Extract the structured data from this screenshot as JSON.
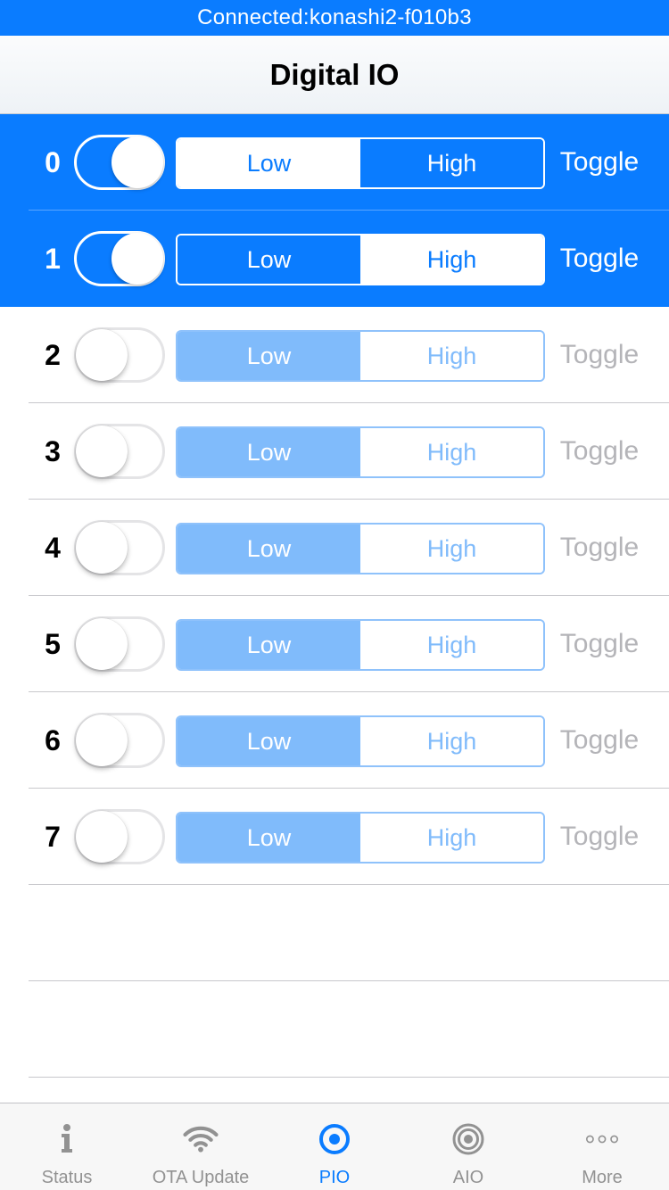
{
  "status_bar": {
    "text": "Connected:konashi2-f010b3"
  },
  "nav": {
    "title": "Digital IO"
  },
  "pins": [
    {
      "number": "0",
      "enabled": true,
      "value": "High",
      "low_label": "Low",
      "high_label": "High",
      "toggle_label": "Toggle"
    },
    {
      "number": "1",
      "enabled": true,
      "value": "Low",
      "low_label": "Low",
      "high_label": "High",
      "toggle_label": "Toggle"
    },
    {
      "number": "2",
      "enabled": false,
      "value": "Low",
      "low_label": "Low",
      "high_label": "High",
      "toggle_label": "Toggle"
    },
    {
      "number": "3",
      "enabled": false,
      "value": "Low",
      "low_label": "Low",
      "high_label": "High",
      "toggle_label": "Toggle"
    },
    {
      "number": "4",
      "enabled": false,
      "value": "Low",
      "low_label": "Low",
      "high_label": "High",
      "toggle_label": "Toggle"
    },
    {
      "number": "5",
      "enabled": false,
      "value": "Low",
      "low_label": "Low",
      "high_label": "High",
      "toggle_label": "Toggle"
    },
    {
      "number": "6",
      "enabled": false,
      "value": "Low",
      "low_label": "Low",
      "high_label": "High",
      "toggle_label": "Toggle"
    },
    {
      "number": "7",
      "enabled": false,
      "value": "Low",
      "low_label": "Low",
      "high_label": "High",
      "toggle_label": "Toggle"
    }
  ],
  "tabs": [
    {
      "label": "Status",
      "icon": "info-icon"
    },
    {
      "label": "OTA Update",
      "icon": "wifi-icon"
    },
    {
      "label": "PIO",
      "icon": "pio-target-icon",
      "active": true
    },
    {
      "label": "AIO",
      "icon": "aio-target-icon"
    },
    {
      "label": "More",
      "icon": "more-dots-icon"
    }
  ],
  "colors": {
    "accent": "#0a7cff",
    "accent_light": "#80bbfb",
    "toggle_disabled": "#b4b4b8",
    "tab_inactive": "#929292"
  }
}
